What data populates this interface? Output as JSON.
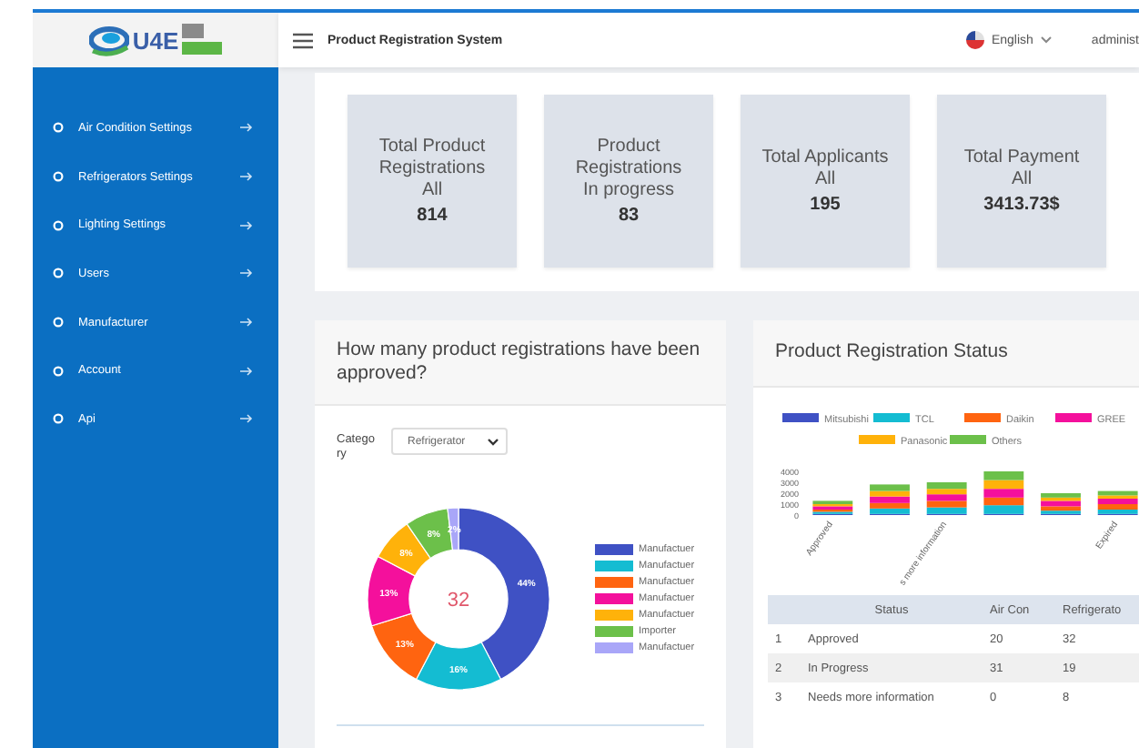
{
  "logo": {
    "text": "U4E"
  },
  "header": {
    "title": "Product Registration System",
    "language": "English",
    "user": "administ"
  },
  "sidebar": {
    "items": [
      {
        "label": "Air Condition Settings"
      },
      {
        "label": "Refrigerators Settings"
      },
      {
        "label": "Lighting Settings"
      },
      {
        "label": "Users"
      },
      {
        "label": "Manufacturer"
      },
      {
        "label": "Account"
      },
      {
        "label": "Api"
      }
    ]
  },
  "stats": [
    {
      "title": "Total Product Registrations",
      "subtitle": "All",
      "value": "814"
    },
    {
      "title": "Product Registrations",
      "subtitle": "In progress",
      "value": "83"
    },
    {
      "title": "Total Applicants",
      "subtitle": "All",
      "value": "195"
    },
    {
      "title": "Total Payment",
      "subtitle": "All",
      "value": "3413.73$"
    }
  ],
  "approved_card": {
    "title": "How many product registrations have been approved?",
    "category_label": "Category",
    "category_value": "Refrigerator",
    "center_text": "32",
    "legend": [
      {
        "label": "Manufactuer",
        "color": "#3f51c4"
      },
      {
        "label": "Manufactuer",
        "color": "#14bcd2"
      },
      {
        "label": "Manufactuer",
        "color": "#ff6410"
      },
      {
        "label": "Manufactuer",
        "color": "#f4109c"
      },
      {
        "label": "Manufactuer",
        "color": "#ffb20a"
      },
      {
        "label": "Importer",
        "color": "#6cc04a"
      },
      {
        "label": "Manufactuer",
        "color": "#a9a6f8"
      }
    ],
    "chart_data": {
      "type": "donut",
      "values": [
        44,
        16,
        13,
        13,
        8,
        8,
        2
      ],
      "value_labels": [
        "44%",
        "16%",
        "13%",
        "13%",
        "8%",
        "8%",
        "2%"
      ]
    }
  },
  "status_card": {
    "title": "Product Registration Status",
    "chart_data": {
      "type": "bar",
      "stacked": true,
      "legend": "top",
      "categories": [
        "Approved",
        null,
        "s more information",
        null,
        null,
        "Expired"
      ],
      "yticks": [
        0,
        1000,
        2000,
        3000,
        4000
      ],
      "ylim": [
        0,
        4000
      ],
      "series": [
        {
          "name": "Mitsubishi",
          "color": "#3f51c4",
          "values": [
            100,
            100,
            100,
            100,
            100,
            100
          ]
        },
        {
          "name": "TCL",
          "color": "#14bcd2",
          "values": [
            200,
            500,
            600,
            800,
            300,
            400
          ]
        },
        {
          "name": "Daikin",
          "color": "#ff6410",
          "values": [
            200,
            500,
            600,
            700,
            400,
            500
          ]
        },
        {
          "name": "GREE",
          "color": "#f4109c",
          "values": [
            300,
            600,
            600,
            800,
            500,
            500
          ]
        },
        {
          "name": "Panasonic",
          "color": "#ffb20a",
          "values": [
            200,
            500,
            500,
            800,
            300,
            300
          ]
        },
        {
          "name": "Others",
          "color": "#6cc04a",
          "values": [
            300,
            600,
            600,
            800,
            400,
            400
          ]
        }
      ]
    },
    "table": {
      "columns": [
        "Status",
        "Air Con",
        "Refrigerato"
      ],
      "rows": [
        {
          "index": "1",
          "cells": [
            "Approved",
            "20",
            "32"
          ]
        },
        {
          "index": "2",
          "cells": [
            "In Progress",
            "31",
            "19"
          ]
        },
        {
          "index": "3",
          "cells": [
            "Needs more information",
            "0",
            "8"
          ]
        }
      ]
    }
  }
}
